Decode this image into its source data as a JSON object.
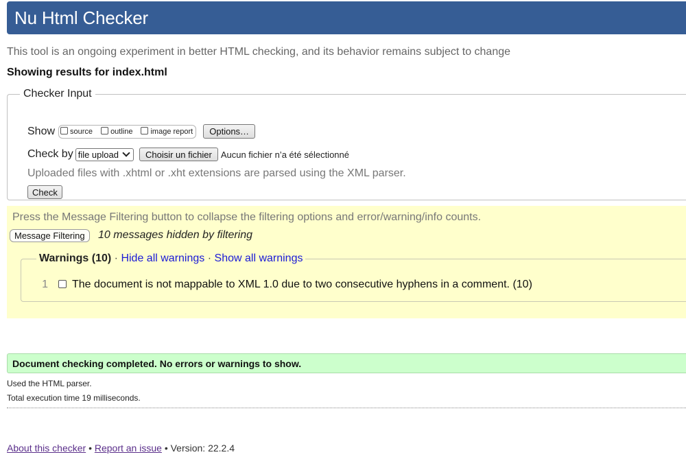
{
  "header": {
    "title": "Nu Html Checker"
  },
  "intro": "This tool is an ongoing experiment in better HTML checking, and its behavior remains subject to change",
  "showing_results": "Showing results for index.html",
  "checker_input": {
    "legend": "Checker Input",
    "show_label": "Show",
    "show_options": [
      {
        "label": "source",
        "checked": false
      },
      {
        "label": "outline",
        "checked": false
      },
      {
        "label": "image report",
        "checked": false
      }
    ],
    "options_button": "Options…",
    "check_by_label": "Check by",
    "check_by_selected": "file upload",
    "choose_file_button": "Choisir un fichier",
    "no_file_text": "Aucun fichier n’a été sélectionné",
    "upload_note": "Uploaded files with .xhtml or .xht extensions are parsed using the XML parser.",
    "check_button": "Check"
  },
  "filtering": {
    "message": "Press the Message Filtering button to collapse the filtering options and error/warning/info counts.",
    "button": "Message Filtering",
    "hidden_count": "10 messages hidden by filtering",
    "warnings": {
      "title": "Warnings (10)",
      "separator": "·",
      "hide_all": "Hide all warnings",
      "show_all": "Show all warnings",
      "items": [
        {
          "number": "1",
          "text": "The document is not mappable to XML 1.0 due to two consecutive hyphens in a comment. (10)",
          "checked": false
        }
      ]
    }
  },
  "result": {
    "success": "Document checking completed. No errors or warnings to show.",
    "parser": "Used the HTML parser.",
    "execution_time": "Total execution time 19 milliseconds."
  },
  "footer": {
    "about_link": "About this checker",
    "bullet": "•",
    "report_link": "Report an issue",
    "version": "Version: 22.2.4"
  },
  "colors": {
    "header_bg": "#365d95",
    "filter_bg": "#ffffcc",
    "success_bg": "#ccffcc",
    "link": "#1a1ad6",
    "visited_link": "#5a2e8a"
  }
}
